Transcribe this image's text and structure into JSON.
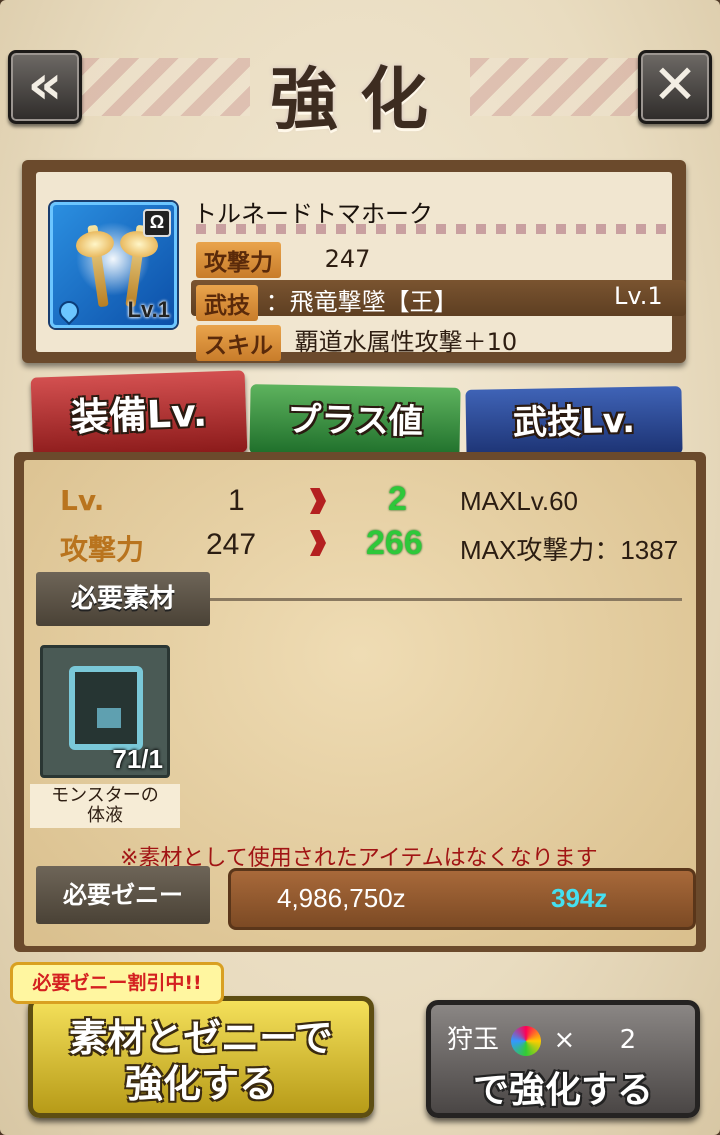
{
  "header": {
    "title": "強化",
    "back_icon": "back-arrow-icon",
    "close_icon": "close-icon"
  },
  "weapon": {
    "name": "トルネードトマホーク",
    "level_badge": "Lv.1",
    "attack_label": "攻撃力",
    "attack_value": "247",
    "art_label": "武技",
    "art_value": "：飛竜撃墜【王】",
    "art_level": "Lv.1",
    "skill_label": "スキル",
    "skill_value": "覇道水属性攻撃＋10"
  },
  "tabs": [
    {
      "label": "装備Lv.",
      "active": true,
      "color": "#b02a2a"
    },
    {
      "label": "プラス値",
      "active": false,
      "color": "#2e8b3a"
    },
    {
      "label": "武技Lv.",
      "active": false,
      "color": "#2a4a96"
    }
  ],
  "stats": {
    "lv_label": "Lv.",
    "lv_current": "1",
    "lv_next": "2",
    "lv_max": "MAXLv.60",
    "atk_label": "攻撃力",
    "atk_current": "247",
    "atk_next": "266",
    "atk_max": "MAX攻撃力：1387"
  },
  "materials": {
    "header": "必要素材",
    "items": [
      {
        "name_line1": "モンスターの",
        "name_line2": "体液",
        "count": "71/1",
        "icon": "monster-fluid-icon"
      }
    ],
    "note": "※素材として使用されたアイテムはなくなります"
  },
  "zeny": {
    "label": "必要ゼニー",
    "cost": "4,986,750z",
    "owned": "394z",
    "owned_color": "#45e0f0"
  },
  "sale_badge": "必要ゼニー割引中!!",
  "buttons": {
    "material_zeny_line1": "素材とゼニーで",
    "material_zeny_line2": "強化する",
    "hunt_label": "狩玉",
    "hunt_times": "×",
    "hunt_count": "2",
    "hunt_line2": "で強化する"
  }
}
